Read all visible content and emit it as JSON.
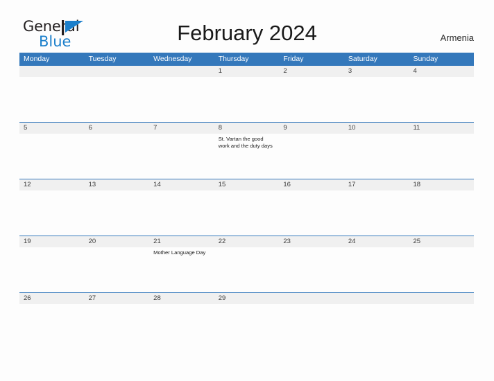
{
  "brand": {
    "name_line1": "General",
    "name_line2": "Blue",
    "flag_icon": "blue-triangle-flag-icon",
    "accent_color": "#1b7fcb"
  },
  "header": {
    "title": "February 2024",
    "region": "Armenia"
  },
  "calendar": {
    "month": "February",
    "year": "2024",
    "header_color": "#3478bb",
    "band_color": "#f0f0f0",
    "weekdays": [
      "Monday",
      "Tuesday",
      "Wednesday",
      "Thursday",
      "Friday",
      "Saturday",
      "Sunday"
    ],
    "weeks": [
      [
        {
          "day": "",
          "event": ""
        },
        {
          "day": "",
          "event": ""
        },
        {
          "day": "",
          "event": ""
        },
        {
          "day": "1",
          "event": ""
        },
        {
          "day": "2",
          "event": ""
        },
        {
          "day": "3",
          "event": ""
        },
        {
          "day": "4",
          "event": ""
        }
      ],
      [
        {
          "day": "5",
          "event": ""
        },
        {
          "day": "6",
          "event": ""
        },
        {
          "day": "7",
          "event": ""
        },
        {
          "day": "8",
          "event": "St. Vartan the good work and the duty days"
        },
        {
          "day": "9",
          "event": ""
        },
        {
          "day": "10",
          "event": ""
        },
        {
          "day": "11",
          "event": ""
        }
      ],
      [
        {
          "day": "12",
          "event": ""
        },
        {
          "day": "13",
          "event": ""
        },
        {
          "day": "14",
          "event": ""
        },
        {
          "day": "15",
          "event": ""
        },
        {
          "day": "16",
          "event": ""
        },
        {
          "day": "17",
          "event": ""
        },
        {
          "day": "18",
          "event": ""
        }
      ],
      [
        {
          "day": "19",
          "event": ""
        },
        {
          "day": "20",
          "event": ""
        },
        {
          "day": "21",
          "event": "Mother Language Day"
        },
        {
          "day": "22",
          "event": ""
        },
        {
          "day": "23",
          "event": ""
        },
        {
          "day": "24",
          "event": ""
        },
        {
          "day": "25",
          "event": ""
        }
      ],
      [
        {
          "day": "26",
          "event": ""
        },
        {
          "day": "27",
          "event": ""
        },
        {
          "day": "28",
          "event": ""
        },
        {
          "day": "29",
          "event": ""
        },
        {
          "day": "",
          "event": ""
        },
        {
          "day": "",
          "event": ""
        },
        {
          "day": "",
          "event": ""
        }
      ]
    ]
  }
}
